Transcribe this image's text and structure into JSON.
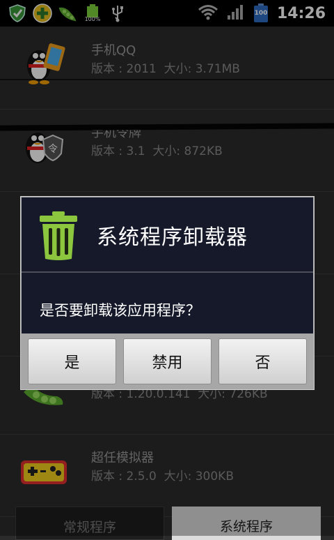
{
  "status_bar": {
    "battery_label": "100%",
    "battery_level": "100",
    "time": "14:26"
  },
  "apps": [
    {
      "name": "手机QQ",
      "info": "版本 : 2011  大小: 3.71MB"
    },
    {
      "name": "手机令牌",
      "info": "版本 : 3.1  大小: 872KB"
    },
    {
      "name": "",
      "info": "版本 : 1.20.0.141  大小: 726KB"
    },
    {
      "name": "超任模拟器",
      "info": "版本 : 2.5.0  大小: 300KB"
    }
  ],
  "tabs": {
    "regular": "常规程序",
    "system": "系统程序"
  },
  "dialog": {
    "title": "系统程序卸载器",
    "message": "是否要卸载该应用程序？",
    "yes": "是",
    "disable": "禁用",
    "no": "否"
  },
  "colors": {
    "dialog_bg": "#15192a",
    "trash_green": "#8cc63f"
  }
}
